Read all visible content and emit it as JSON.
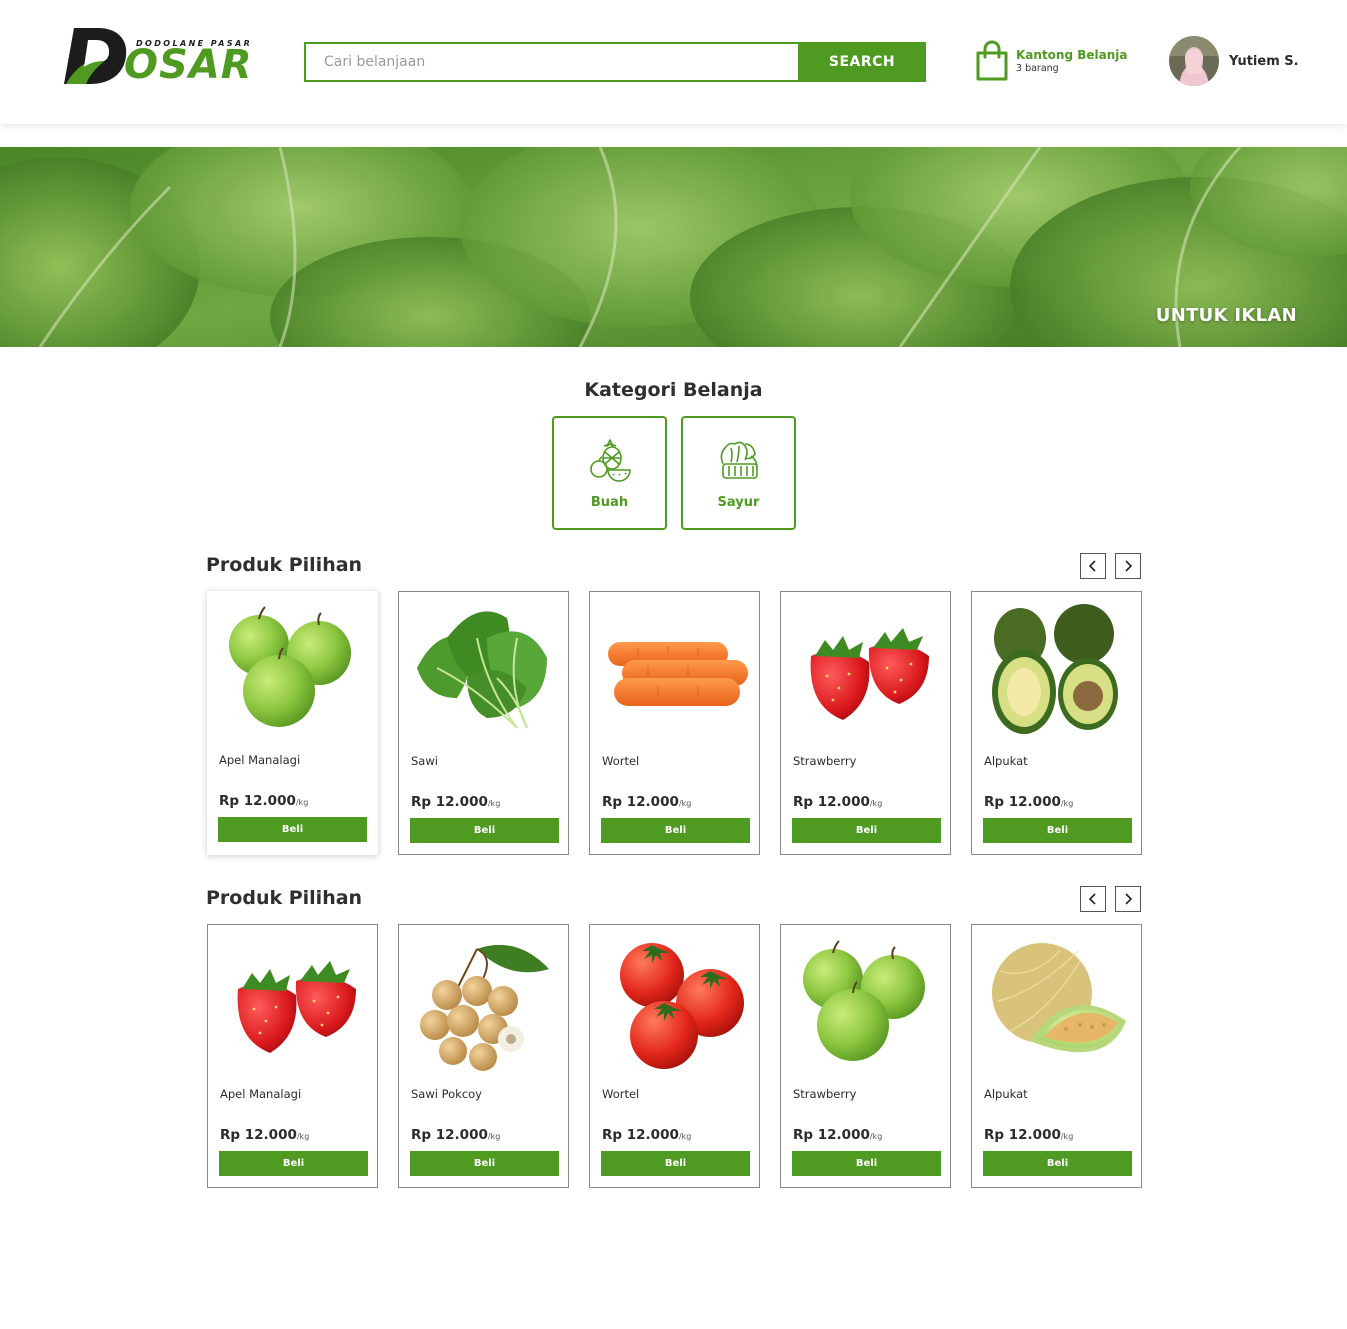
{
  "brand": {
    "tagline": "DODOLANE PASAR",
    "name": "OSAR",
    "accent": "#4f9b22"
  },
  "search": {
    "placeholder": "Cari belanjaan",
    "button": "SEARCH"
  },
  "cart": {
    "title": "Kantong Belanja",
    "count": "3 barang",
    "icon": "shopping-bag-icon"
  },
  "user": {
    "name": "Yutiem S.",
    "icon": "avatar"
  },
  "banner": {
    "text": "UNTUK IKLAN"
  },
  "categories": {
    "title": "Kategori Belanja",
    "items": [
      {
        "label": "Buah",
        "icon": "fruit-icon"
      },
      {
        "label": "Sayur",
        "icon": "vegetable-icon"
      }
    ]
  },
  "sections": [
    {
      "title": "Produk Pilihan",
      "products": [
        {
          "name": "Apel Manalagi",
          "price": "Rp 12.000",
          "unit": "/kg",
          "button": "Beli",
          "image": "green-apples"
        },
        {
          "name": "Sawi",
          "price": "Rp 12.000",
          "unit": "/kg",
          "button": "Beli",
          "image": "mustard-greens"
        },
        {
          "name": "Wortel",
          "price": "Rp 12.000",
          "unit": "/kg",
          "button": "Beli",
          "image": "carrots"
        },
        {
          "name": "Strawberry",
          "price": "Rp 12.000",
          "unit": "/kg",
          "button": "Beli",
          "image": "strawberries"
        },
        {
          "name": "Alpukat",
          "price": "Rp 12.000",
          "unit": "/kg",
          "button": "Beli",
          "image": "avocados"
        }
      ]
    },
    {
      "title": "Produk Pilihan",
      "products": [
        {
          "name": "Apel Manalagi",
          "price": "Rp 12.000",
          "unit": "/kg",
          "button": "Beli",
          "image": "strawberries"
        },
        {
          "name": "Sawi Pokcoy",
          "price": "Rp 12.000",
          "unit": "/kg",
          "button": "Beli",
          "image": "longan"
        },
        {
          "name": "Wortel",
          "price": "Rp 12.000",
          "unit": "/kg",
          "button": "Beli",
          "image": "tomatoes"
        },
        {
          "name": "Strawberry",
          "price": "Rp 12.000",
          "unit": "/kg",
          "button": "Beli",
          "image": "green-apples"
        },
        {
          "name": "Alpukat",
          "price": "Rp 12.000",
          "unit": "/kg",
          "button": "Beli",
          "image": "melon"
        }
      ]
    }
  ]
}
